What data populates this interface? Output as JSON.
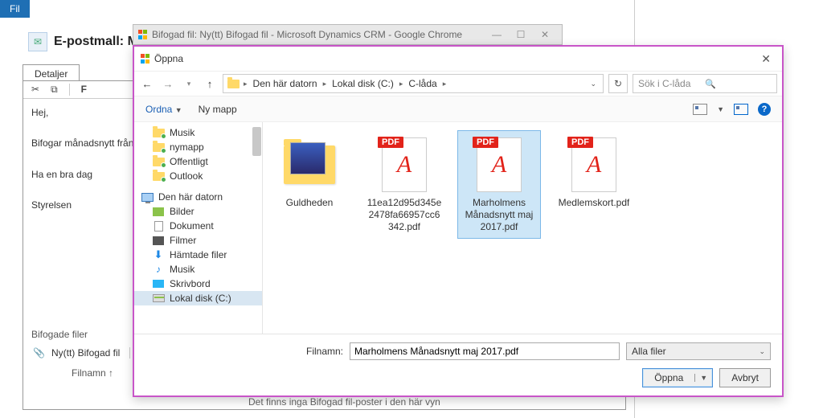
{
  "crm": {
    "fileTab": "Fil",
    "title": "E-postmall: M",
    "detailsTab": "Detaljer",
    "toolbar": {
      "cut": "✂",
      "copy": "⧉",
      "f": "F"
    },
    "body": {
      "greeting": "Hej,",
      "line1": "Bifogar månadsnytt från",
      "line2": "Ha en bra dag",
      "sign": "Styrelsen"
    },
    "attachedLabel": "Bifogade filer",
    "newAttach": "Ny(tt) Bifogad fil",
    "fileNameCol": "Filnamn ↑",
    "bottom": "Det finns inga Bifogad fil-poster i den här vyn"
  },
  "chromePopup": {
    "title": "Bifogad fil: Ny(tt) Bifogad fil - Microsoft Dynamics CRM - Google Chrome",
    "min": "—",
    "max": "☐",
    "close": "✕"
  },
  "dialog": {
    "title": "Öppna",
    "nav": {
      "back": "←",
      "fwd": "→",
      "up": "↑"
    },
    "breadcrumb": {
      "root": "Den här datorn",
      "drive": "Lokal disk (C:)",
      "folder": "C-låda"
    },
    "refresh": "↻",
    "search": {
      "placeholder": "Sök i C-låda",
      "icon": "🔍"
    },
    "toolbar": {
      "organize": "Ordna",
      "newFolder": "Ny mapp"
    },
    "tree": {
      "quick": [
        {
          "label": "Musik"
        },
        {
          "label": "nymapp"
        },
        {
          "label": "Offentligt"
        },
        {
          "label": "Outlook"
        }
      ],
      "pcLabel": "Den här datorn",
      "pcItems": [
        {
          "label": "Bilder",
          "kind": "pic"
        },
        {
          "label": "Dokument",
          "kind": "doc"
        },
        {
          "label": "Filmer",
          "kind": "film"
        },
        {
          "label": "Hämtade filer",
          "kind": "dl"
        },
        {
          "label": "Musik",
          "kind": "note"
        },
        {
          "label": "Skrivbord",
          "kind": "desk"
        },
        {
          "label": "Lokal disk (C:)",
          "kind": "drive",
          "selected": true
        }
      ]
    },
    "files": [
      {
        "name": "Guldheden",
        "kind": "folder"
      },
      {
        "name": "11ea12d95d345e2478fa66957cc6342.pdf",
        "kind": "pdf"
      },
      {
        "name": "Marholmens Månadsnytt maj 2017.pdf",
        "kind": "pdf",
        "selected": true
      },
      {
        "name": "Medlemskort.pdf",
        "kind": "pdf"
      }
    ],
    "pdfBadge": "PDF",
    "filenameLabel": "Filnamn:",
    "filenameValue": "Marholmens Månadsnytt maj 2017.pdf",
    "filter": "Alla filer",
    "openBtn": "Öppna",
    "cancelBtn": "Avbryt"
  }
}
